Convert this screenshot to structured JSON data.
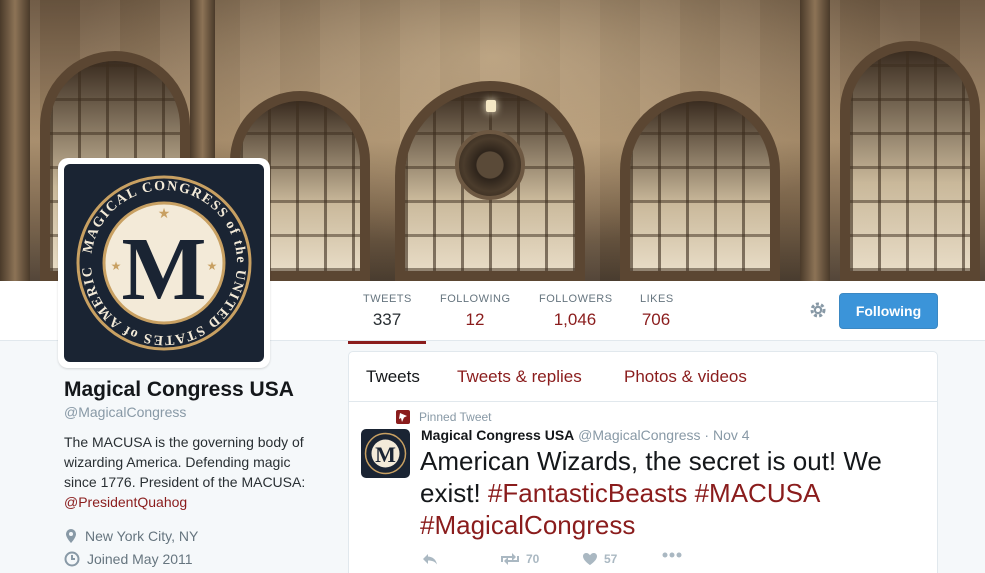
{
  "profile": {
    "name": "Magical Congress USA",
    "handle": "@MagicalCongress",
    "bio_text": "The MACUSA is the governing body of wizarding America. Defending magic since 1776. President of the MACUSA:",
    "bio_mention": "@PresidentQuahog",
    "location": "New York City, NY",
    "joined": "Joined May 2011",
    "avatar_seal_text": "MAGICAL CONGRESS of the UNITED STATES of AMERICA",
    "avatar_letter": "M"
  },
  "nav": {
    "stats": [
      {
        "label": "TWEETS",
        "value": "337"
      },
      {
        "label": "FOLLOWING",
        "value": "12"
      },
      {
        "label": "FOLLOWERS",
        "value": "1,046"
      },
      {
        "label": "LIKES",
        "value": "706"
      }
    ],
    "follow_button": "Following"
  },
  "timeline": {
    "tabs": [
      "Tweets",
      "Tweets & replies",
      "Photos & videos"
    ],
    "tweet": {
      "pinned_label": "Pinned Tweet",
      "author": "Magical Congress USA",
      "handle": "@MagicalCongress",
      "date": "Nov 4",
      "text": "American Wizards, the secret is out! We exist!",
      "hashtags": [
        "#FantasticBeasts",
        "#MACUSA",
        "#MagicalCongress"
      ],
      "retweets": "70",
      "likes": "57"
    }
  },
  "colors": {
    "accent": "#8a1c1c",
    "follow_button": "#3b94d9",
    "seal_navy": "#1a2433",
    "seal_gold": "#c8a062"
  }
}
